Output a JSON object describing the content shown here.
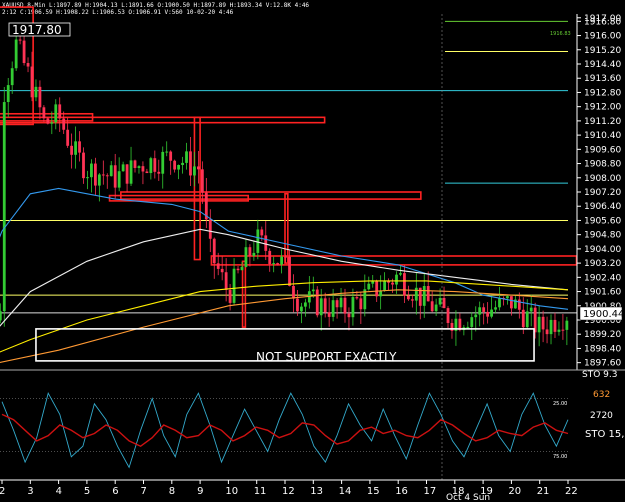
{
  "window": {
    "header_line1": "XAUUSD 8-Min L:1897.89 H:1904.13 L:1891.66 O:1900.50 H:1897.89 H:1893.34 V:12.8K 4:46",
    "header_line2": "2:12 C:1906.59 H:1908.22 L:1906.53 O:1906.91 V:560 10-02-20 4:46"
  },
  "colors": {
    "background": "#000000",
    "up_candle": "#33cc33",
    "down_candle": "#ff3355",
    "support_box": "#ff2222",
    "highlight_box": "#ffffff",
    "level_yellow": "#ffff66",
    "level_cyan": "#33ccdd",
    "level_green": "#66cc33",
    "ema_blue": "#3399ee",
    "ema_white": "#eeeeee",
    "ema_orange": "#ff9933",
    "ema_yellow": "#ffee00",
    "stoch_fast": "#33aacc",
    "stoch_slow": "#cc1111",
    "axis_text": "#ffffff"
  },
  "chart_data": [
    {
      "type": "candlestick",
      "symbol": "XAUUSD",
      "interval": "8-Min",
      "ylim": [
        1897.3,
        1917.1
      ],
      "y_ticks": [
        "1917.00",
        "1916.80",
        "1916.00",
        "1915.20",
        "1914.40",
        "1913.60",
        "1912.80",
        "1912.00",
        "1911.20",
        "1910.40",
        "1909.60",
        "1908.80",
        "1908.00",
        "1907.20",
        "1906.40",
        "1905.60",
        "1904.80",
        "1904.00",
        "1903.20",
        "1902.40",
        "1901.60",
        "1900.80",
        "1900.00",
        "1899.20",
        "1898.40",
        "1897.60"
      ],
      "x_ticks": [
        "2",
        "3",
        "4",
        "5",
        "6",
        "7",
        "8",
        "9",
        "10",
        "11",
        "12",
        "13",
        "14",
        "15",
        "16",
        "17",
        "18",
        "19",
        "20",
        "21",
        "22"
      ],
      "date_label": "Oct 4 Sun",
      "last_price": "1900.44",
      "labels": {
        "price_label": "1917.80",
        "box_note": "NOT SUPPORT EXACTLY",
        "small_level_note": "1916.83"
      },
      "horizontal_levels": [
        {
          "name": "green-level",
          "value": 1916.8,
          "color": "#66cc33"
        },
        {
          "name": "yellow-level-top",
          "value": 1915.1,
          "color": "#ffff66"
        },
        {
          "name": "cyan-level-top",
          "value": 1912.9,
          "color": "#33ccdd"
        },
        {
          "name": "cyan-level-mid",
          "value": 1907.7,
          "color": "#33ccdd"
        },
        {
          "name": "yellow-level-mid",
          "value": 1905.6,
          "color": "#ffff66"
        },
        {
          "name": "yellow-level-low",
          "value": 1901.4,
          "color": "#ffff66"
        },
        {
          "name": "white-level",
          "value": 1900.4,
          "color": "#dddddd"
        }
      ],
      "zones": [
        {
          "name": "zone-top",
          "x_from": 1.0,
          "x_to": 3.1,
          "y_low": 1911.0,
          "y_high": 1917.6,
          "color": "#ff2222"
        },
        {
          "name": "zone-1911",
          "x_from": 1.6,
          "x_to": 13.4,
          "y_low": 1911.1,
          "y_high": 1911.4,
          "color": "#ff2222"
        },
        {
          "name": "zone-1911-left",
          "x_from": 1.6,
          "x_to": 5.2,
          "y_low": 1911.2,
          "y_high": 1911.6,
          "color": "#ff2222"
        },
        {
          "name": "zone-1907",
          "x_from": 6.2,
          "x_to": 16.8,
          "y_low": 1906.8,
          "y_high": 1907.2,
          "color": "#ff2222"
        },
        {
          "name": "zone-1907-b",
          "x_from": 5.8,
          "x_to": 10.7,
          "y_low": 1906.7,
          "y_high": 1907.0,
          "color": "#ff2222"
        },
        {
          "name": "zone-1903",
          "x_from": 9.4,
          "x_to": 22.3,
          "y_low": 1903.1,
          "y_high": 1903.6,
          "color": "#ff2222"
        },
        {
          "name": "zone-1911-vertical",
          "x_from": 8.8,
          "x_to": 9.0,
          "y_low": 1903.4,
          "y_high": 1911.4,
          "color": "#ff2222"
        },
        {
          "name": "zone-1907-vertical",
          "x_from": 12.0,
          "x_to": 12.1,
          "y_low": 1903.2,
          "y_high": 1907.1,
          "color": "#ff2222"
        },
        {
          "name": "zone-1903-vertical",
          "x_from": 10.5,
          "x_to": 10.6,
          "y_low": 1899.6,
          "y_high": 1903.3,
          "color": "#ff2222"
        }
      ],
      "highlight_box": {
        "x_from": 3.2,
        "x_to": 20.8,
        "y_low": 1897.7,
        "y_high": 1899.5
      },
      "moving_averages": [
        {
          "name": "ema-blue",
          "color": "#3399ee",
          "points": [
            [
              1,
              1901.0
            ],
            [
              2,
              1905.0
            ],
            [
              3,
              1907.1
            ],
            [
              4,
              1907.4
            ],
            [
              6,
              1906.8
            ],
            [
              8,
              1906.5
            ],
            [
              9,
              1906.1
            ],
            [
              10,
              1905.0
            ],
            [
              12,
              1904.3
            ],
            [
              14,
              1903.6
            ],
            [
              16,
              1903.1
            ],
            [
              18,
              1902.1
            ],
            [
              19,
              1901.4
            ],
            [
              20,
              1901.1
            ],
            [
              21,
              1900.8
            ],
            [
              22,
              1900.6
            ]
          ]
        },
        {
          "name": "ema-white",
          "color": "#eeeeee",
          "points": [
            [
              1,
              1898.0
            ],
            [
              3,
              1901.6
            ],
            [
              5,
              1903.3
            ],
            [
              7,
              1904.4
            ],
            [
              9,
              1905.1
            ],
            [
              10,
              1904.8
            ],
            [
              12,
              1904.0
            ],
            [
              14,
              1903.3
            ],
            [
              16,
              1902.8
            ],
            [
              18,
              1902.4
            ],
            [
              20,
              1902.0
            ],
            [
              22,
              1901.7
            ]
          ]
        },
        {
          "name": "ema-yellow",
          "color": "#ffee00",
          "points": [
            [
              1,
              1897.6
            ],
            [
              3,
              1898.9
            ],
            [
              5,
              1900.0
            ],
            [
              7,
              1900.8
            ],
            [
              9,
              1901.6
            ],
            [
              11,
              1901.9
            ],
            [
              13,
              1902.1
            ],
            [
              15,
              1902.2
            ],
            [
              17,
              1902.2
            ],
            [
              19,
              1902.0
            ],
            [
              22,
              1901.7
            ]
          ]
        },
        {
          "name": "ema-orange",
          "color": "#ff9933",
          "points": [
            [
              1,
              1897.3
            ],
            [
              4,
              1898.3
            ],
            [
              7,
              1899.6
            ],
            [
              10,
              1900.8
            ],
            [
              12,
              1901.2
            ],
            [
              14,
              1901.5
            ],
            [
              16,
              1901.7
            ],
            [
              18,
              1901.6
            ],
            [
              20,
              1901.4
            ],
            [
              22,
              1901.2
            ]
          ]
        }
      ],
      "candles_summary": "Price falls from about 1916 near the start, ranges 1908-1911, drops to 1904 after x=9 and ranges 1899-1903 into the close near 1900.44."
    },
    {
      "type": "line",
      "name": "STO",
      "labels": {
        "top": "STO 9.3",
        "side_high": "632",
        "side_mid": "2720",
        "sto_label": "STO 15,",
        "level_25": "25.00",
        "level_75": "75.00"
      },
      "levels": [
        25,
        75
      ],
      "series": [
        {
          "name": "fast",
          "color": "#33aacc",
          "values": [
            28,
            55,
            85,
            62,
            20,
            40,
            80,
            70,
            30,
            45,
            70,
            90,
            55,
            25,
            60,
            80,
            40,
            20,
            50,
            85,
            60,
            35,
            55,
            75,
            45,
            20,
            40,
            70,
            85,
            60,
            30,
            50,
            65,
            35,
            60,
            82,
            50,
            20,
            40,
            65,
            80,
            55,
            30,
            60,
            75,
            40,
            20,
            50,
            70,
            45
          ]
        },
        {
          "name": "slow",
          "color": "#cc1111",
          "values": [
            40,
            45,
            55,
            65,
            60,
            50,
            55,
            62,
            58,
            50,
            55,
            65,
            70,
            62,
            50,
            55,
            62,
            60,
            50,
            55,
            65,
            60,
            52,
            55,
            62,
            58,
            48,
            50,
            60,
            68,
            65,
            55,
            52,
            58,
            55,
            60,
            62,
            55,
            45,
            50,
            58,
            65,
            62,
            55,
            58,
            60,
            52,
            48,
            55,
            58
          ]
        }
      ]
    }
  ]
}
